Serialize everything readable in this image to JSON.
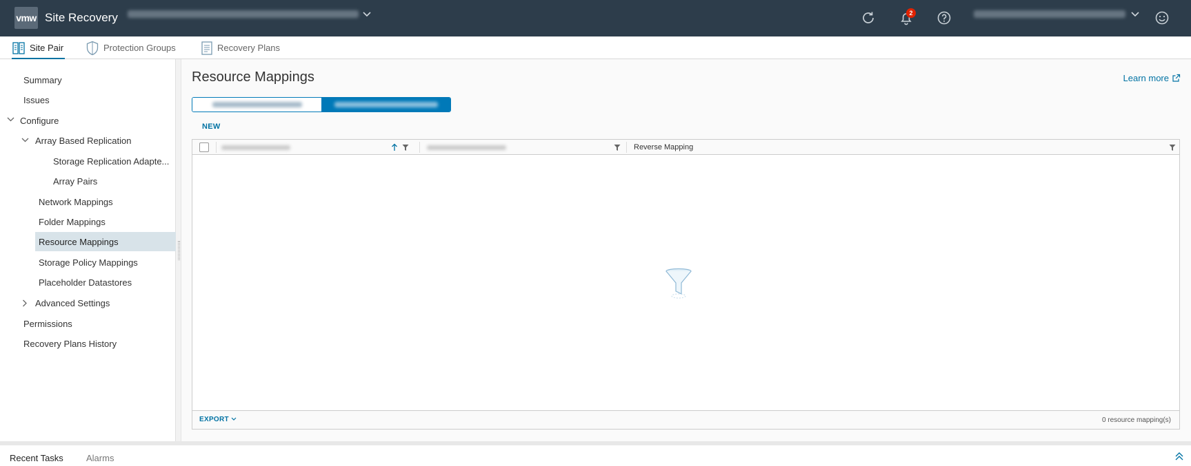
{
  "header": {
    "logo": "vmw",
    "app_title": "Site Recovery",
    "site_pair_selector": "",
    "notification_count": "2",
    "user_menu": ""
  },
  "tabs": [
    {
      "label": "Site Pair",
      "active": true
    },
    {
      "label": "Protection Groups",
      "active": false
    },
    {
      "label": "Recovery Plans",
      "active": false
    }
  ],
  "sidebar": {
    "items": [
      {
        "label": "Summary"
      },
      {
        "label": "Issues"
      },
      {
        "label": "Configure",
        "expanded": true
      },
      {
        "label": "Array Based Replication",
        "expanded": true
      },
      {
        "label": "Storage Replication Adapte..."
      },
      {
        "label": "Array Pairs"
      },
      {
        "label": "Network Mappings"
      },
      {
        "label": "Folder Mappings"
      },
      {
        "label": "Resource Mappings",
        "selected": true
      },
      {
        "label": "Storage Policy Mappings"
      },
      {
        "label": "Placeholder Datastores"
      },
      {
        "label": "Advanced Settings",
        "expanded": false
      },
      {
        "label": "Permissions"
      },
      {
        "label": "Recovery Plans History"
      }
    ]
  },
  "main": {
    "title": "Resource Mappings",
    "learn_more": "Learn more",
    "new_button": "NEW",
    "grid": {
      "columns": [
        "",
        "",
        "Reverse Mapping"
      ],
      "export_label": "EXPORT",
      "footer_count": "0 resource mapping(s)"
    }
  },
  "bottom": {
    "tabs": [
      "Recent Tasks",
      "Alarms"
    ]
  },
  "colors": {
    "header_bg": "#2d3d4b",
    "accent": "#0072a3",
    "selected_nav": "#d8e3e9",
    "badge": "#e12200"
  }
}
